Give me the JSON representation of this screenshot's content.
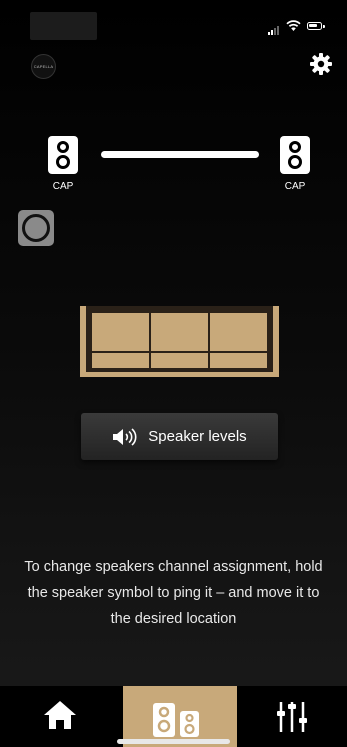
{
  "status_bar": {
    "signal": "cellular-signal-icon",
    "wifi": "wifi-icon",
    "battery": "battery-icon"
  },
  "header": {
    "logo_text": "CAPELLA",
    "settings_icon": "gear-icon"
  },
  "speakers": [
    {
      "label": "CAP"
    },
    {
      "label": "CAP"
    }
  ],
  "ping_control": {
    "icon": "ring-icon"
  },
  "levels_button": {
    "label": "Speaker levels",
    "icon": "speaker-volume-icon"
  },
  "hint": "To change speakers channel assignment, hold the speaker symbol to ping it – and move it to the desired location",
  "tabs": [
    {
      "name": "home",
      "icon": "home-icon",
      "active": false
    },
    {
      "name": "speakers",
      "icon": "speakers-icon",
      "active": true
    },
    {
      "name": "mixer",
      "icon": "mixer-sliders-icon",
      "active": false
    }
  ],
  "colors": {
    "accent": "#c8a97a",
    "background": "#000000",
    "button": "#2e2e2e"
  }
}
